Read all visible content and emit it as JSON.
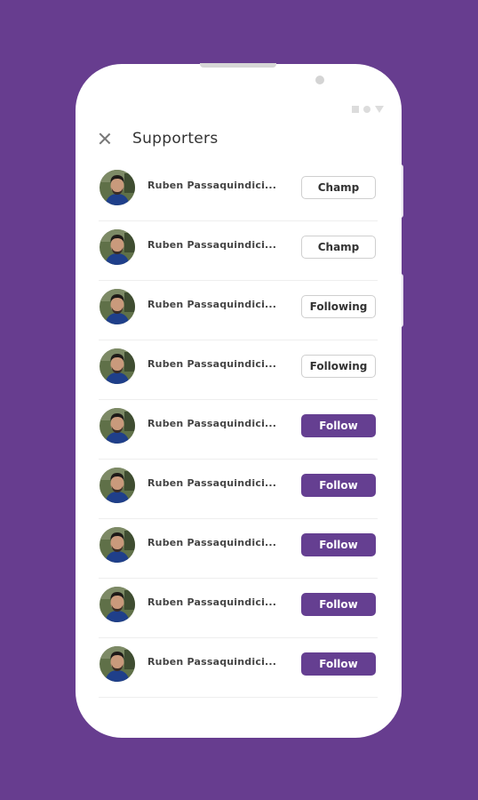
{
  "colors": {
    "background": "#673d8f",
    "accent": "#653f91",
    "card": "#ffffff"
  },
  "header": {
    "close_icon": "close-icon",
    "title": "Supporters"
  },
  "supporters": [
    {
      "name": "Ruben Passaquindici...",
      "action": "Champ",
      "style": "outline"
    },
    {
      "name": "Ruben Passaquindici...",
      "action": "Champ",
      "style": "outline"
    },
    {
      "name": "Ruben Passaquindici...",
      "action": "Following",
      "style": "outline"
    },
    {
      "name": "Ruben Passaquindici...",
      "action": "Following",
      "style": "outline"
    },
    {
      "name": "Ruben Passaquindici...",
      "action": "Follow",
      "style": "filled"
    },
    {
      "name": "Ruben Passaquindici...",
      "action": "Follow",
      "style": "filled"
    },
    {
      "name": "Ruben Passaquindici...",
      "action": "Follow",
      "style": "filled"
    },
    {
      "name": "Ruben Passaquindici...",
      "action": "Follow",
      "style": "filled"
    },
    {
      "name": "Ruben Passaquindici...",
      "action": "Follow",
      "style": "filled"
    }
  ]
}
